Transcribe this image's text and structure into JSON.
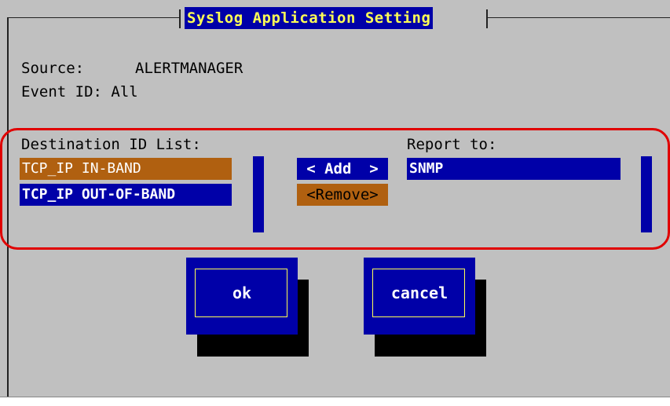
{
  "dialog": {
    "title": "Syslog Application Setting",
    "source_label": "Source:",
    "source_value": "ALERTMANAGER",
    "event_id_text": "Event ID: All"
  },
  "destination": {
    "header": "Destination ID List:",
    "items": [
      {
        "label": "TCP_IP IN-BAND",
        "state": "highlighted"
      },
      {
        "label": "TCP_IP OUT-OF-BAND",
        "state": "selected"
      }
    ]
  },
  "actions": {
    "add_label": "< Add  >",
    "remove_label": "<Remove>"
  },
  "report": {
    "header": "Report to:",
    "items": [
      {
        "label": "SNMP",
        "state": "selected"
      }
    ]
  },
  "buttons": {
    "ok_label": "ok",
    "cancel_label": "cancel"
  },
  "colors": {
    "dialog_bg": "#c0c0c0",
    "selection_blue": "#0000a8",
    "selection_orange": "#b06010",
    "title_text": "#ffff55",
    "callout_red": "#e00000"
  }
}
